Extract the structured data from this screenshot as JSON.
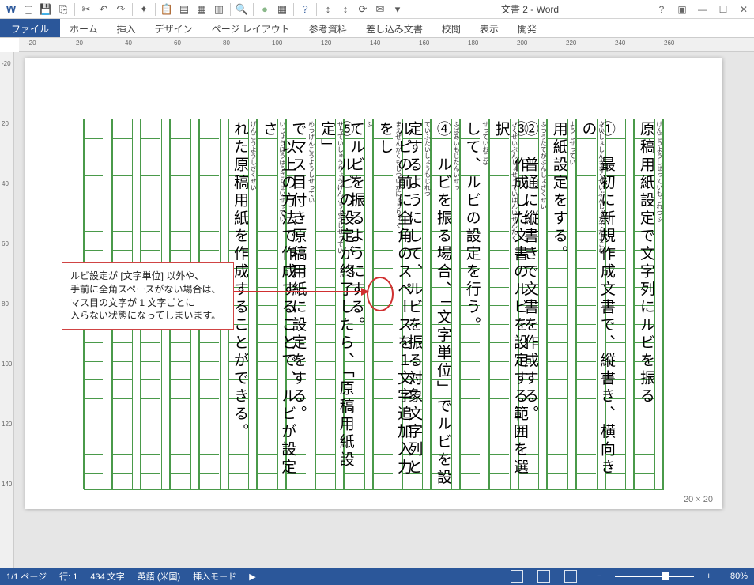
{
  "window": {
    "title": "文書 2 - Word"
  },
  "ribbon": {
    "file": "ファイル",
    "tabs": [
      "ホーム",
      "挿入",
      "デザイン",
      "ページ レイアウト",
      "参考資料",
      "差し込み文書",
      "校閲",
      "表示",
      "開発"
    ]
  },
  "ruler_h": [
    "-20",
    "20",
    "40",
    "60",
    "80",
    "100",
    "120",
    "140",
    "160",
    "180",
    "200",
    "220",
    "240",
    "260"
  ],
  "ruler_v": [
    "-20",
    "20",
    "40",
    "60",
    "80",
    "100",
    "120",
    "140"
  ],
  "columns": [
    {
      "main": "原稿用紙設定で文字列にルビを振る",
      "ruby": "げんこうようしせっていもじれつふ"
    },
    {
      "main": "",
      "ruby": ""
    },
    {
      "main": "①　最初に新規作成文書で、縦書き、横向きの",
      "ruby": "さいしょしんきさくせいぶんしょたてがよこむ"
    },
    {
      "main": "用紙設定をする。",
      "ruby": "ようしせってい"
    },
    {
      "main": "②　普通に縦書きで文書を作成する。",
      "ruby": "ふつうたてがぶんしょさくせい"
    },
    {
      "main": "③　作成した文書のルビを設定する範囲を選択",
      "ruby": "さくせいぶんしょせっていはんいせんたく"
    },
    {
      "main": "して、ルビの設定を行う。",
      "ruby": "せっていおこな"
    },
    {
      "main": "④　ルビを振る場合、「文字単位」でルビを設",
      "ruby": "ふばあいもじたんいせっ"
    },
    {
      "main": "定するようにして、ルビを振る対象文字列と",
      "ruby": "ていふたいしょうもじれつ"
    },
    {
      "main": "ルビの前に全角のスペースを１文字追加入力をし",
      "ruby": "まえぜんかくもじついかにゅうりょく"
    },
    {
      "main": "てルビを振るようにする。",
      "ruby": "ふ"
    },
    {
      "main": "⑤　ルビの設定が終了したら、「原稿用紙設定」",
      "ruby": "せっていしゅうりょうげんこうようしせってい"
    },
    {
      "main": "でマス目付き原稿用紙に設定をする。",
      "ruby": "めつげんこうようしせってい"
    },
    {
      "main": "　以上の方法で作成することで、ルビが設定さ",
      "ruby": "いじょうほうほうさくせいせってい"
    },
    {
      "main": "れた原稿用紙を作成することができる。",
      "ruby": "げんこうようしさくせい"
    },
    {
      "main": "",
      "ruby": ""
    },
    {
      "main": "",
      "ruby": ""
    },
    {
      "main": "",
      "ruby": ""
    },
    {
      "main": "",
      "ruby": ""
    },
    {
      "main": "",
      "ruby": ""
    }
  ],
  "callout": {
    "line1": "ルビ設定が [文字単位] 以外や、",
    "line2": "手前に全角スペースがない場合は、",
    "line3": "マス目の文字が 1 文字ごとに",
    "line4": "入らない状態になってしまいます。"
  },
  "page_info": "20 × 20",
  "statusbar": {
    "page": "1/1 ページ",
    "line": "行: 1",
    "chars": "434 文字",
    "lang": "英語 (米国)",
    "mode": "挿入モード",
    "zoom": "80%"
  }
}
